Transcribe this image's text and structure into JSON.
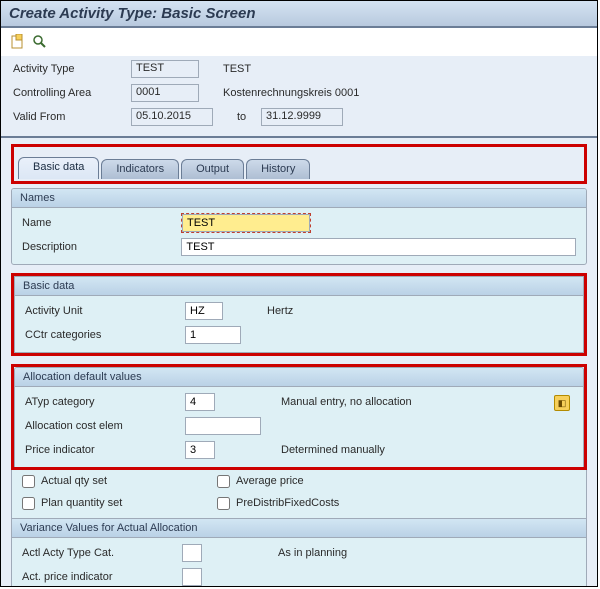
{
  "title": "Create Activity Type: Basic Screen",
  "header": {
    "activity_type_label": "Activity Type",
    "activity_type_value": "TEST",
    "activity_type_desc": "TEST",
    "controlling_area_label": "Controlling Area",
    "controlling_area_value": "0001",
    "controlling_area_desc": "Kostenrechnungskreis 0001",
    "valid_from_label": "Valid From",
    "valid_from_value": "05.10.2015",
    "to_label": "to",
    "to_value": "31.12.9999"
  },
  "tabs": {
    "basic_data": "Basic data",
    "indicators": "Indicators",
    "output": "Output",
    "history": "History"
  },
  "names_group": {
    "title": "Names",
    "name_label": "Name",
    "name_value": "TEST",
    "description_label": "Description",
    "description_value": "TEST"
  },
  "basic_group": {
    "title": "Basic data",
    "activity_unit_label": "Activity Unit",
    "activity_unit_value": "HZ",
    "activity_unit_desc": "Hertz",
    "cctr_label": "CCtr categories",
    "cctr_value": "1"
  },
  "alloc_group": {
    "title": "Allocation default values",
    "atyp_label": "ATyp category",
    "atyp_value": "4",
    "atyp_desc": "Manual entry, no allocation",
    "alloc_cost_label": "Allocation cost elem",
    "alloc_cost_value": "",
    "price_ind_label": "Price indicator",
    "price_ind_value": "3",
    "price_ind_desc": "Determined manually",
    "actual_qty_label": "Actual qty set",
    "average_price_label": "Average price",
    "plan_qty_label": "Plan quantity set",
    "predistrib_label": "PreDistribFixedCosts",
    "variance_header": "Variance Values for Actual Allocation",
    "actl_acty_label": "Actl Acty Type Cat.",
    "actl_acty_value": "",
    "actl_acty_desc": "As in planning",
    "act_price_label": "Act. price indicator",
    "act_price_value": ""
  }
}
